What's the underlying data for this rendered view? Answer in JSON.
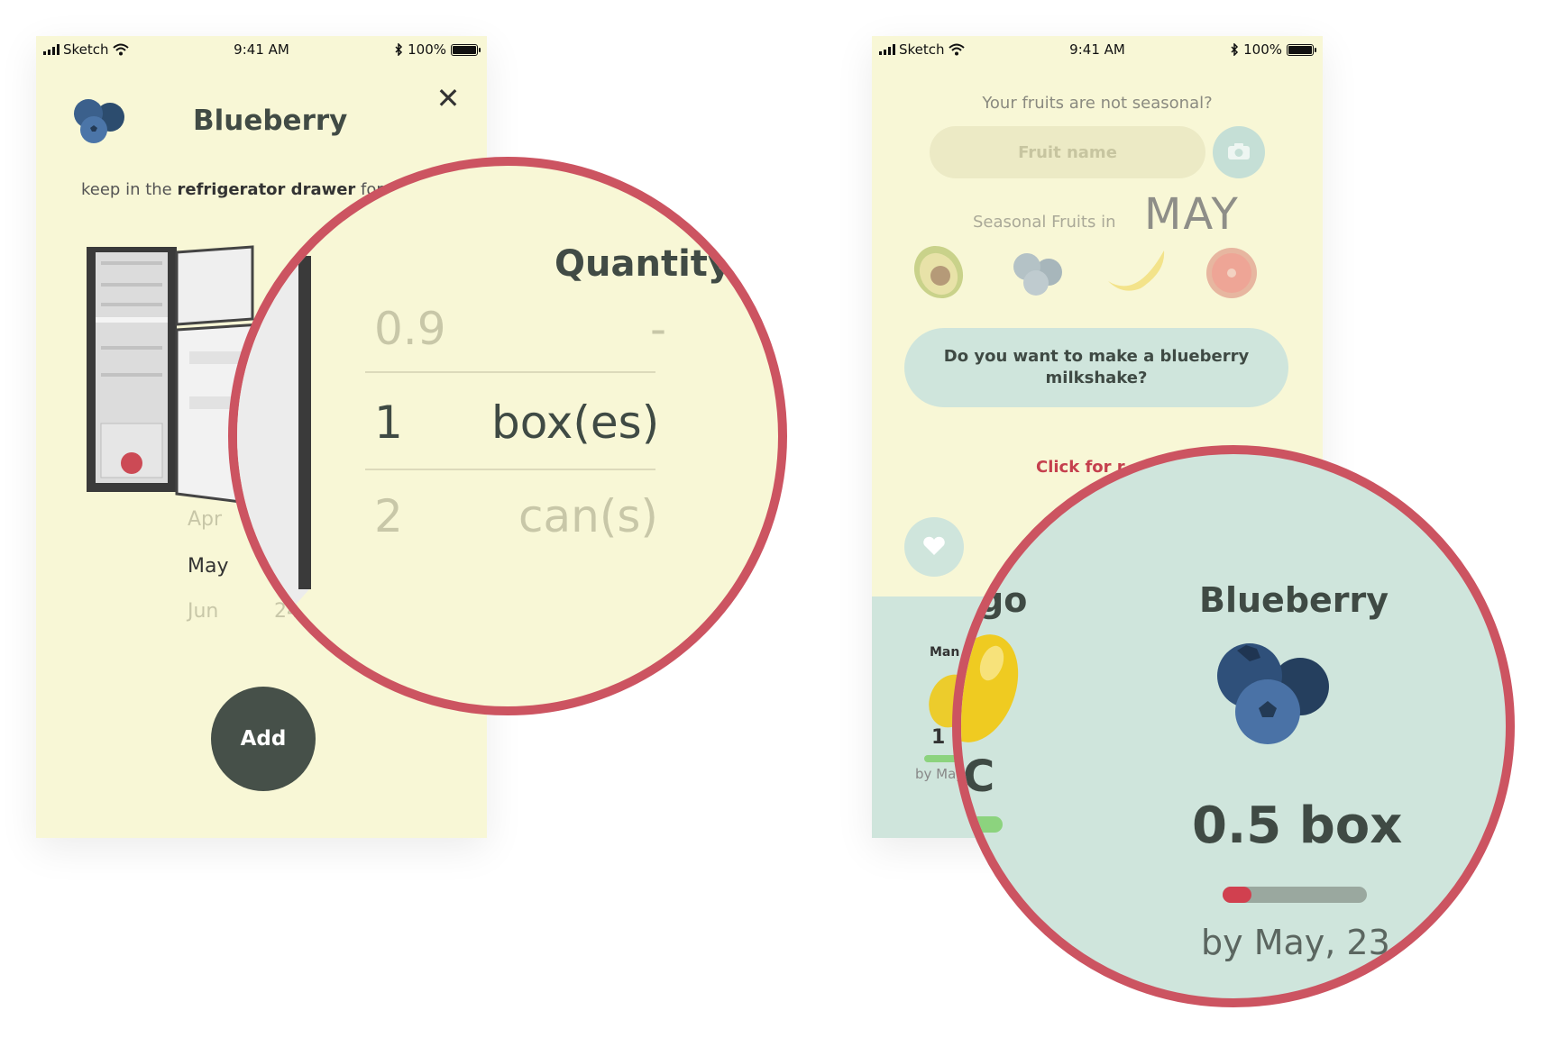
{
  "status": {
    "carrier": "Sketch",
    "time": "9:41 AM",
    "battery": "100%",
    "battery_level": 1.0
  },
  "left": {
    "title": "Blueberry",
    "keep_prefix": "keep in the ",
    "keep_bold": "refrigerator drawer",
    "keep_suffix": " for ",
    "date_picker": [
      {
        "month": "Apr",
        "day": ""
      },
      {
        "month": "May",
        "day": ""
      },
      {
        "month": "Jun",
        "day": "24"
      }
    ],
    "add_label": "Add",
    "icons": {
      "close": "close-icon",
      "fruit": "blueberry-icon",
      "fridge": "fridge-illustration"
    }
  },
  "left_zoom": {
    "title": "Quantity",
    "rows": [
      {
        "value": "0.9",
        "unit": "-"
      },
      {
        "value": "1",
        "unit": "box(es)"
      },
      {
        "value": "2",
        "unit": "can(s)"
      }
    ]
  },
  "right": {
    "question": "Your fruits are not seasonal?",
    "input_placeholder": "Fruit name",
    "seasonal_label": "Seasonal Fruits in",
    "month": "MAY",
    "seasonal_fruits": [
      "avocado-icon",
      "blueberry-icon",
      "banana-icon",
      "grapefruit-icon"
    ],
    "milkshake_line1": "Do you want to make a blueberry",
    "milkshake_line2": "milkshake?",
    "click_for": "Click for r",
    "panel_label": "Man",
    "panel_qty": "1 p",
    "panel_by": "by May,",
    "panel_progress": 0.8,
    "panel_progress_color": "#8cd37e"
  },
  "right_zoom": {
    "partial_title": "go",
    "partial_letter": "C",
    "title": "Blueberry",
    "quantity": "0.5 box",
    "progress": 0.2,
    "progress_color": "#d1404f",
    "by": "by May, 23"
  },
  "colors": {
    "background": "#f8f7d6",
    "accent": "#cc5461",
    "mint": "#cfe5dc",
    "dark": "#465049"
  }
}
